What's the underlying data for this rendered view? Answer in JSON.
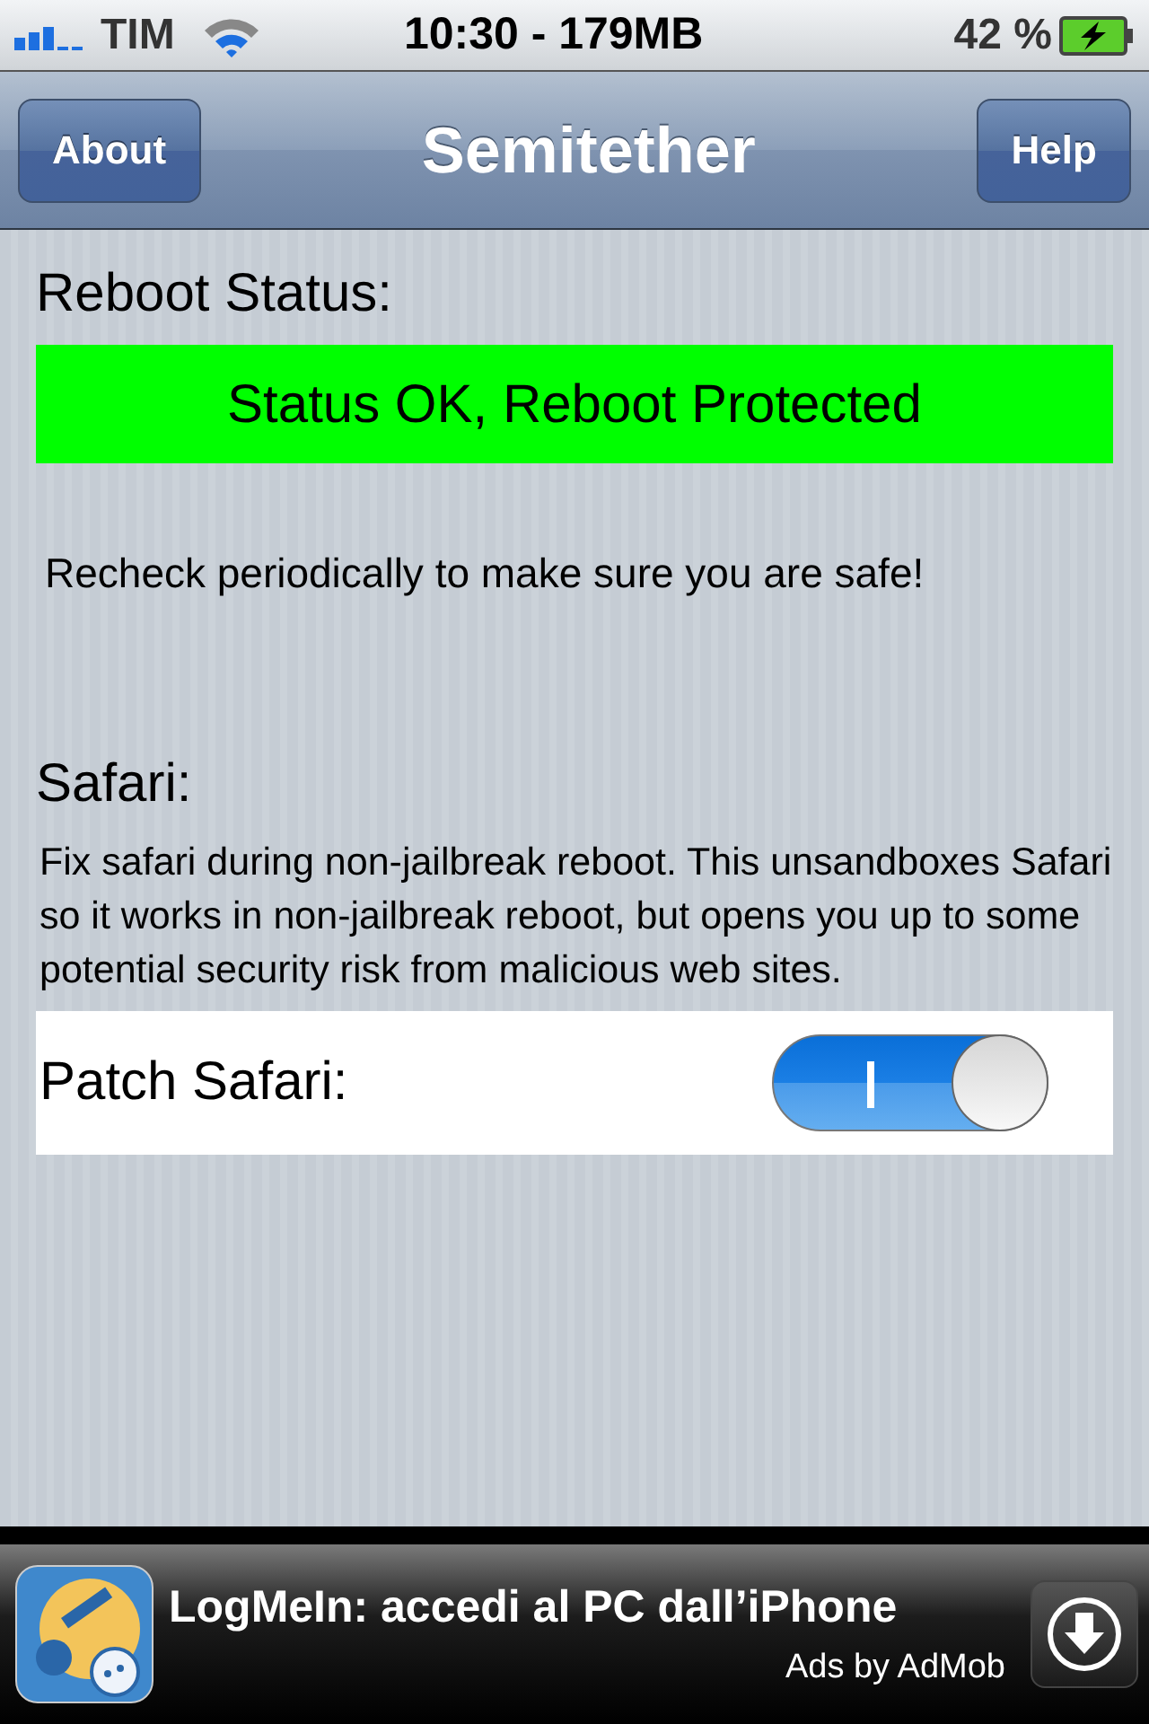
{
  "status_bar": {
    "carrier": "TIM",
    "time": "10:30 - 179MB",
    "battery": "42 %"
  },
  "nav_bar": {
    "left_button": "About",
    "title": "Semitether",
    "right_button": "Help"
  },
  "reboot_status": {
    "heading": "Reboot Status:",
    "status": "Status OK, Reboot Protected",
    "note": "Recheck periodically to make sure you are safe!"
  },
  "safari": {
    "heading": "Safari:",
    "description": "Fix safari during non-jailbreak reboot. This unsandboxes Safari so it works in non-jailbreak reboot, but opens you up to some potential security risk from malicious web sites.",
    "switch": {
      "label": "Patch Safari:",
      "on": true
    }
  },
  "ad": {
    "title": "LogMeIn: accedi al PC dall’iPhone",
    "byline": "Ads by AdMob"
  }
}
